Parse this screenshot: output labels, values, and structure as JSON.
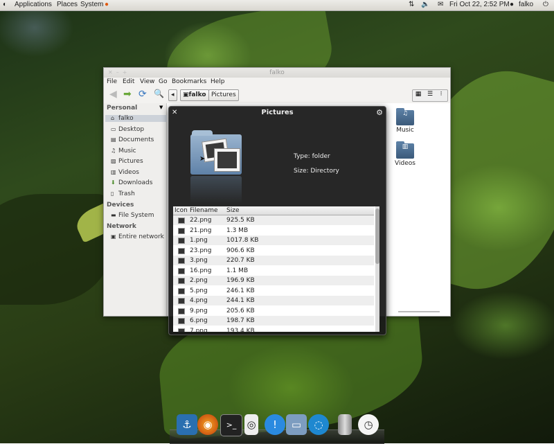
{
  "top_panel": {
    "menus": [
      "Applications",
      "Places",
      "System"
    ],
    "datetime": "Fri Oct 22,  2:52 PM",
    "user": "falko"
  },
  "file_manager": {
    "title": "falko",
    "menu": [
      "File",
      "Edit",
      "View",
      "Go",
      "Bookmarks",
      "Help"
    ],
    "breadcrumbs": [
      "falko",
      "Pictures"
    ],
    "sidebar": {
      "personal_header": "Personal",
      "personal_items": [
        "falko",
        "Desktop",
        "Documents",
        "Music",
        "Pictures",
        "Videos",
        "Downloads",
        "Trash"
      ],
      "devices_header": "Devices",
      "devices_items": [
        "File System"
      ],
      "network_header": "Network",
      "network_items": [
        "Entire network"
      ]
    },
    "files": [
      "Music",
      "Videos"
    ]
  },
  "popup": {
    "title": "Pictures",
    "type_label": "Type: folder",
    "size_label": "Size: Directory",
    "columns": [
      "Icon",
      "Filename",
      "Size"
    ],
    "rows": [
      [
        "22.png",
        "925.5 KB"
      ],
      [
        "21.png",
        "1.3 MB"
      ],
      [
        "1.png",
        "1017.8 KB"
      ],
      [
        "23.png",
        "906.6 KB"
      ],
      [
        "3.png",
        "220.7 KB"
      ],
      [
        "16.png",
        "1.1 MB"
      ],
      [
        "2.png",
        "196.9 KB"
      ],
      [
        "5.png",
        "246.1 KB"
      ],
      [
        "4.png",
        "244.1 KB"
      ],
      [
        "9.png",
        "205.6 KB"
      ],
      [
        "6.png",
        "198.7 KB"
      ],
      [
        "7.png",
        "193.4 KB"
      ]
    ]
  },
  "dock": {
    "icons": [
      "anchor-icon",
      "firefox-icon",
      "terminal-icon",
      "ipod-icon",
      "chat-icon",
      "folder-icon",
      "network-icon",
      "trash-icon",
      "clock-icon"
    ]
  }
}
